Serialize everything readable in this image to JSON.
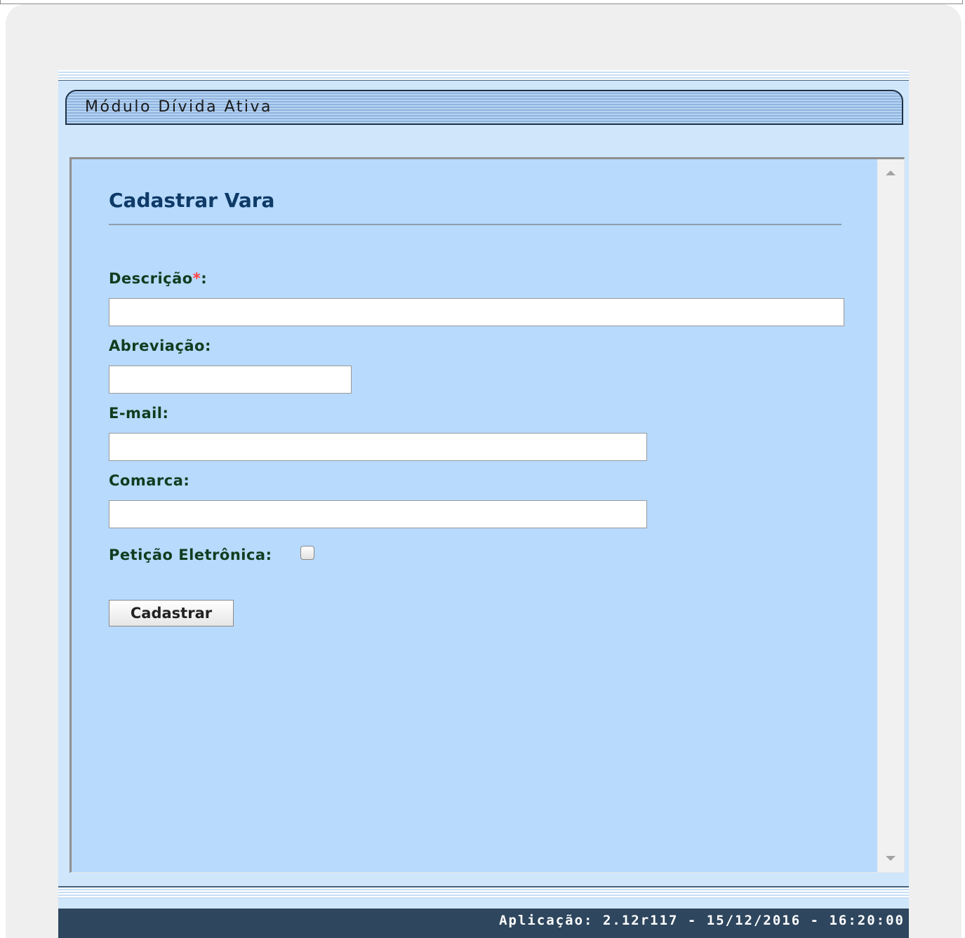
{
  "module": {
    "title": "Módulo Dívida Ativa"
  },
  "form": {
    "title": "Cadastrar Vara",
    "fields": {
      "descricao": {
        "label": "Descrição",
        "required_mark": "*",
        "suffix": ":",
        "value": ""
      },
      "abreviacao": {
        "label": "Abreviação:",
        "value": ""
      },
      "email": {
        "label": "E-mail:",
        "value": ""
      },
      "comarca": {
        "label": "Comarca:",
        "value": ""
      },
      "peticao": {
        "label": "Petição Eletrônica:",
        "checked": false
      }
    },
    "submit_label": "Cadastrar"
  },
  "statusbar": {
    "text": "Aplicação: 2.12r117 - 15/12/2016 - 16:20:00"
  },
  "colors": {
    "content_bg": "#b7dafd",
    "title": "#0e3a67",
    "label": "#0f3d1f",
    "required": "#ff4040",
    "statusbar_bg": "#2e465e"
  }
}
